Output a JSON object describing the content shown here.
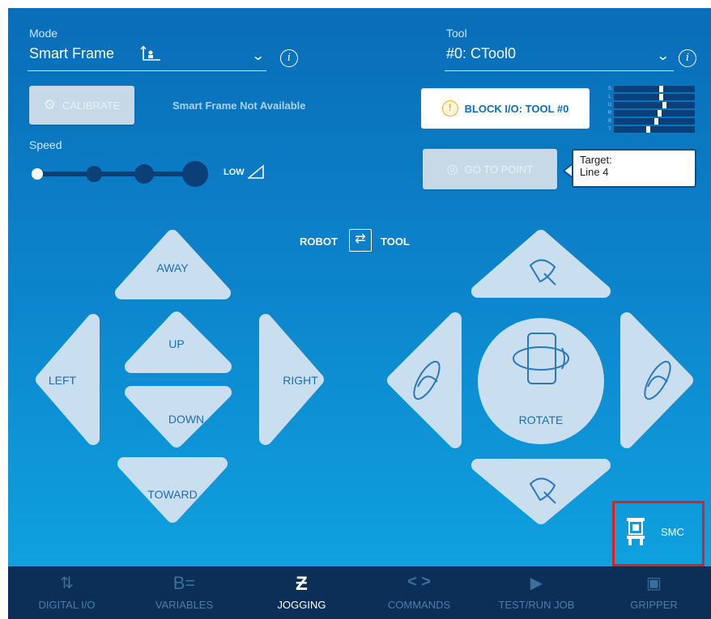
{
  "mode": {
    "label": "Mode",
    "value": "Smart Frame",
    "icon": "frame-axes-icon"
  },
  "tool": {
    "label": "Tool",
    "value": "#0: CTool0"
  },
  "calibrate": {
    "label": "CALIBRATE",
    "note": "Smart Frame Not Available"
  },
  "speed": {
    "label": "Speed",
    "level_label": "LOW",
    "levels": 4,
    "selected": 1
  },
  "block_io": {
    "label": "BLOCK I/O: TOOL #0",
    "icon_text": "!"
  },
  "io_indicator": {
    "letters": [
      "S",
      "L",
      "U",
      "R",
      "B",
      "T"
    ]
  },
  "go_to_point": {
    "label": "GO TO POINT"
  },
  "target": {
    "line1": "Target:",
    "line2": "Line 4"
  },
  "frame_toggle": {
    "left": "ROBOT",
    "right": "TOOL",
    "icon": "⇄"
  },
  "jog": {
    "away": "AWAY",
    "toward": "TOWARD",
    "left": "LEFT",
    "right": "RIGHT",
    "up": "UP",
    "down": "DOWN",
    "rotate": "ROTATE"
  },
  "smc": {
    "label": "SMC"
  },
  "nav": [
    {
      "label": "DIGITAL I/O",
      "icon": "⇅",
      "active": false
    },
    {
      "label": "VARIABLES",
      "icon": "B=",
      "active": false
    },
    {
      "label": "JOGGING",
      "icon": "Ƶ",
      "active": true
    },
    {
      "label": "COMMANDS",
      "icon": "< >",
      "active": false
    },
    {
      "label": "TEST/RUN JOB",
      "icon": "▶",
      "active": false
    },
    {
      "label": "GRIPPER",
      "icon": "▣",
      "active": false
    }
  ],
  "colors": {
    "panel": "#0c84cc",
    "jog_button": "#c9dff0",
    "highlight": "#e11d1d",
    "nav": "#0b2f56"
  }
}
